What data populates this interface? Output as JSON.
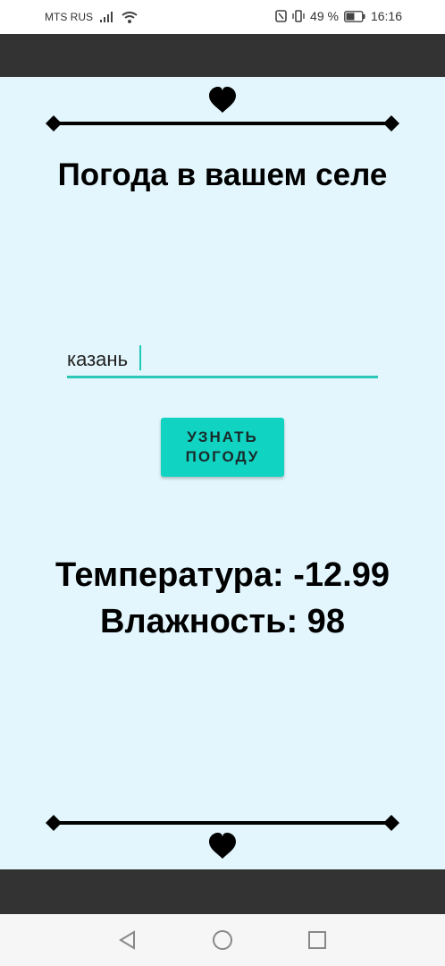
{
  "status_bar": {
    "carrier": "MTS RUS",
    "battery": "49 %",
    "time": "16:16"
  },
  "app": {
    "title": "Погода в вашем селе",
    "city_input": {
      "value": "казань",
      "placeholder": ""
    },
    "button_label": "УЗНАТЬ\nПОГОДУ",
    "temperature_text": "Температура: -12.99",
    "humidity_text": "Влажность: 98"
  },
  "colors": {
    "background": "#e3f6fd",
    "accent": "#10d3c2",
    "bars": "#333333"
  },
  "icons": [
    "signal-icon",
    "wifi-icon",
    "nfc-icon",
    "vibrate-icon",
    "battery-icon",
    "heart-icon",
    "back-icon",
    "home-icon",
    "recents-icon"
  ]
}
